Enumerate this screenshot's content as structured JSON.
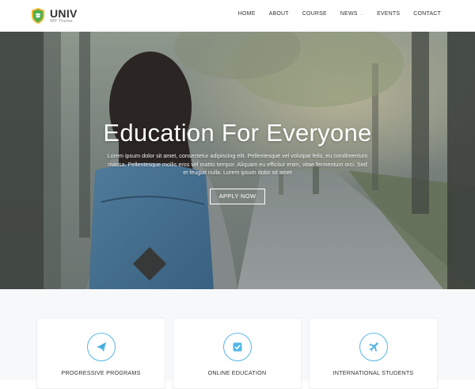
{
  "header": {
    "logo_title": "UNIV",
    "logo_subtitle": "WP Theme",
    "nav": [
      {
        "label": "HOME"
      },
      {
        "label": "ABOUT"
      },
      {
        "label": "COURSE"
      },
      {
        "label": "NEWS",
        "has_dropdown": true
      },
      {
        "label": "EVENTS"
      },
      {
        "label": "CONTACT"
      }
    ]
  },
  "hero": {
    "title": "Education For Everyone",
    "description": "Lorem ipsum dolor sit amet, consectetur adipiscing elit. Pellentesque vel volutpat felis, eu condimentum massa. Pellentesque mollis eros vel mattis tempor. Aliquam eu efficitur enim, vitae fermentum orci. Sed et feugiat nulla. Lorem ipsum dolor sit amet",
    "button_label": "APPLY NOW"
  },
  "features": [
    {
      "label": "PROGRESSIVE PROGRAMS",
      "icon": "paper-plane-icon"
    },
    {
      "label": "ONLINE EDUCATION",
      "icon": "checkbox-icon"
    },
    {
      "label": "INTERNATIONAL STUDENTS",
      "icon": "airplane-icon"
    }
  ],
  "colors": {
    "accent": "#56b7e8",
    "text": "#333333",
    "hero_overlay": "#6e7876"
  }
}
